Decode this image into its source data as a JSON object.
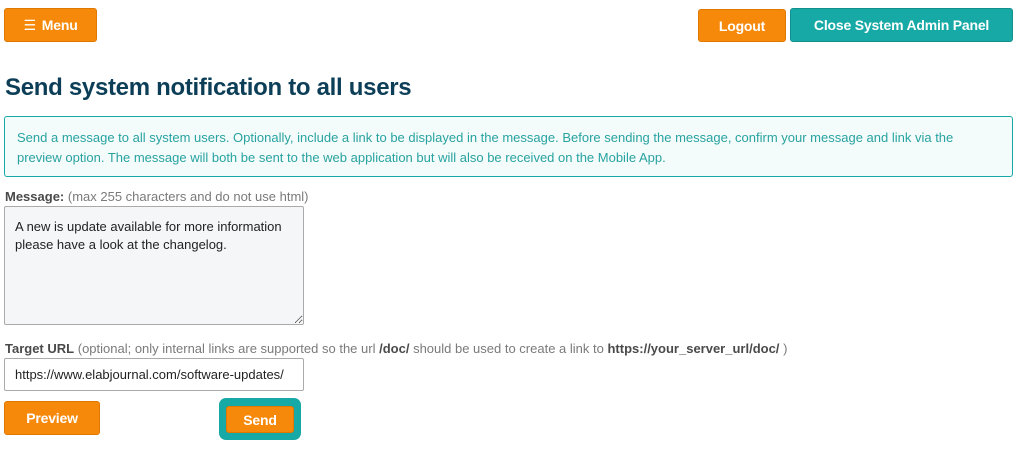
{
  "header": {
    "menu_icon": "☰",
    "menu_label": "Menu",
    "logout_label": "Logout",
    "close_label": "Close System Admin Panel"
  },
  "page": {
    "title": "Send system notification to all users",
    "info_text": "Send a message to all system users. Optionally, include a link to be displayed in the message. Before sending the message, confirm your message and link via the preview option. The message will both be sent to the web application but will also be received on the Mobile App."
  },
  "form": {
    "message_label": "Message:",
    "message_hint": "(max 255 characters and do not use html)",
    "message_value": "A new is update available for more information please have a look at the changelog.",
    "url_label": "Target URL",
    "url_hint_1": "(optional; only internal links are supported so the url",
    "url_hint_path": "/doc/",
    "url_hint_2": "should be used to create a link to",
    "url_hint_full": "https://your_server_url/doc/",
    "url_hint_3": ")",
    "url_value": "https://www.elabjournal.com/software-updates/",
    "preview_label": "Preview",
    "send_label": "Send"
  },
  "colors": {
    "orange": "#f7890a",
    "teal": "#17a9a6",
    "title": "#0c3e57"
  }
}
